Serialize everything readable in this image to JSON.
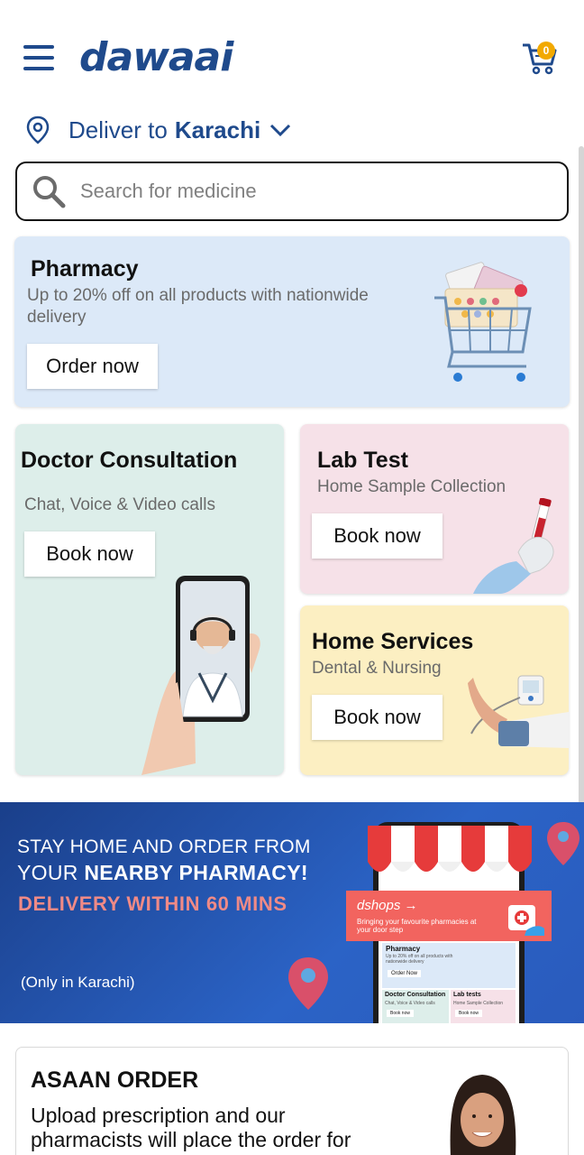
{
  "app": {
    "logo_text": "dawaai",
    "cart_count": "0",
    "brand_color": "#1f4a8c"
  },
  "location": {
    "prefix": "Deliver to",
    "city": "Karachi"
  },
  "search": {
    "placeholder": "Search for medicine"
  },
  "cards": {
    "pharmacy": {
      "title": "Pharmacy",
      "subtitle": "Up to 20% off on all products with nationwide delivery",
      "cta": "Order now"
    },
    "doctor": {
      "title": "Doctor Consultation",
      "subtitle": "Chat, Voice & Video calls",
      "cta": "Book now"
    },
    "lab": {
      "title": "Lab Test",
      "subtitle": "Home Sample Collection",
      "cta": "Book now"
    },
    "home": {
      "title": "Home Services",
      "subtitle": "Dental & Nursing",
      "cta": "Book now"
    }
  },
  "banner": {
    "line1": "STAY HOME AND ORDER FROM",
    "line2_prefix": "YOUR",
    "line2_bold": "NEARBY PHARMACY!",
    "line3": "DELIVERY WITHIN 60 MINS",
    "note": "(Only in Karachi)",
    "dshops_title": "dshops →",
    "dshops_sub": "Bringing your favourite pharmacies at your door step",
    "phone_pharmacy": "Pharmacy",
    "phone_pharmacy_sub": "Up to 20% off on all products with nationwide delivery",
    "phone_order": "Order Now",
    "phone_doctor": "Doctor Consultation",
    "phone_doctor_sub": "Chat, Voice & Video calls",
    "phone_lab": "Lab tests",
    "phone_lab_sub": "Home Sample Collection",
    "phone_book": "Book now"
  },
  "asaan": {
    "title": "ASAAN ORDER",
    "text": "Upload prescription and our pharmacists will place the order for"
  },
  "icons": [
    "menu-icon",
    "cart-icon",
    "location-pin-icon",
    "chevron-down-icon",
    "search-icon"
  ]
}
